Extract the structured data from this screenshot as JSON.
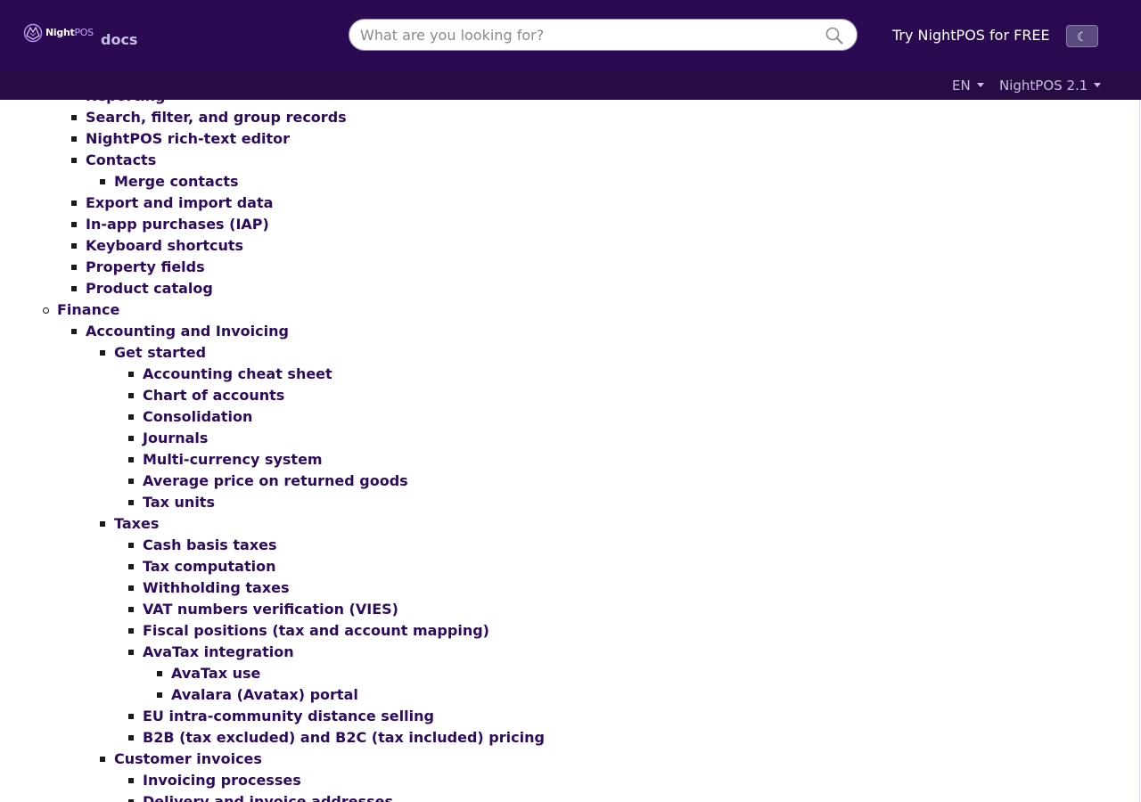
{
  "header": {
    "logo_text_bold": "Night",
    "logo_text_accent": "POS",
    "docs_label": "docs",
    "search_placeholder": "What are you looking for?",
    "try_free_label": "Try NightPOS for FREE",
    "theme_toggle_icon": "moon-icon",
    "theme_toggle_glyph": "☾"
  },
  "subheader": {
    "language": "EN",
    "version": "NightPOS 2.1"
  },
  "colors": {
    "header_bg": "#2a0b52",
    "subheader_bg": "#260b45",
    "link": "#2c0a5e"
  },
  "toc": {
    "items": [
      {
        "label": "Reporting",
        "level": 2
      },
      {
        "label": "Search, filter, and group records",
        "level": 2
      },
      {
        "label": "NightPOS rich-text editor",
        "level": 2
      },
      {
        "label": "Contacts",
        "level": 2
      },
      {
        "label": "Merge contacts",
        "level": 3
      },
      {
        "label": "Export and import data",
        "level": 2
      },
      {
        "label": "In-app purchases (IAP)",
        "level": 2
      },
      {
        "label": "Keyboard shortcuts",
        "level": 2
      },
      {
        "label": "Property fields",
        "level": 2
      },
      {
        "label": "Product catalog",
        "level": 2
      },
      {
        "label": "Finance",
        "level": 1
      },
      {
        "label": "Accounting and Invoicing",
        "level": 2
      },
      {
        "label": "Get started",
        "level": 3
      },
      {
        "label": "Accounting cheat sheet",
        "level": 4
      },
      {
        "label": "Chart of accounts",
        "level": 4
      },
      {
        "label": "Consolidation",
        "level": 4
      },
      {
        "label": "Journals",
        "level": 4
      },
      {
        "label": "Multi-currency system",
        "level": 4
      },
      {
        "label": "Average price on returned goods",
        "level": 4
      },
      {
        "label": "Tax units",
        "level": 4
      },
      {
        "label": "Taxes",
        "level": 3
      },
      {
        "label": "Cash basis taxes",
        "level": 4
      },
      {
        "label": "Tax computation",
        "level": 4
      },
      {
        "label": "Withholding taxes",
        "level": 4
      },
      {
        "label": "VAT numbers verification (VIES)",
        "level": 4
      },
      {
        "label": "Fiscal positions (tax and account mapping)",
        "level": 4
      },
      {
        "label": "AvaTax integration",
        "level": 4
      },
      {
        "label": "AvaTax use",
        "level": 5
      },
      {
        "label": "Avalara (Avatax) portal",
        "level": 5
      },
      {
        "label": "EU intra-community distance selling",
        "level": 4
      },
      {
        "label": "B2B (tax excluded) and B2C (tax included) pricing",
        "level": 4
      },
      {
        "label": "Customer invoices",
        "level": 3
      },
      {
        "label": "Invoicing processes",
        "level": 4
      },
      {
        "label": "Delivery and invoice addresses",
        "level": 4
      }
    ]
  }
}
